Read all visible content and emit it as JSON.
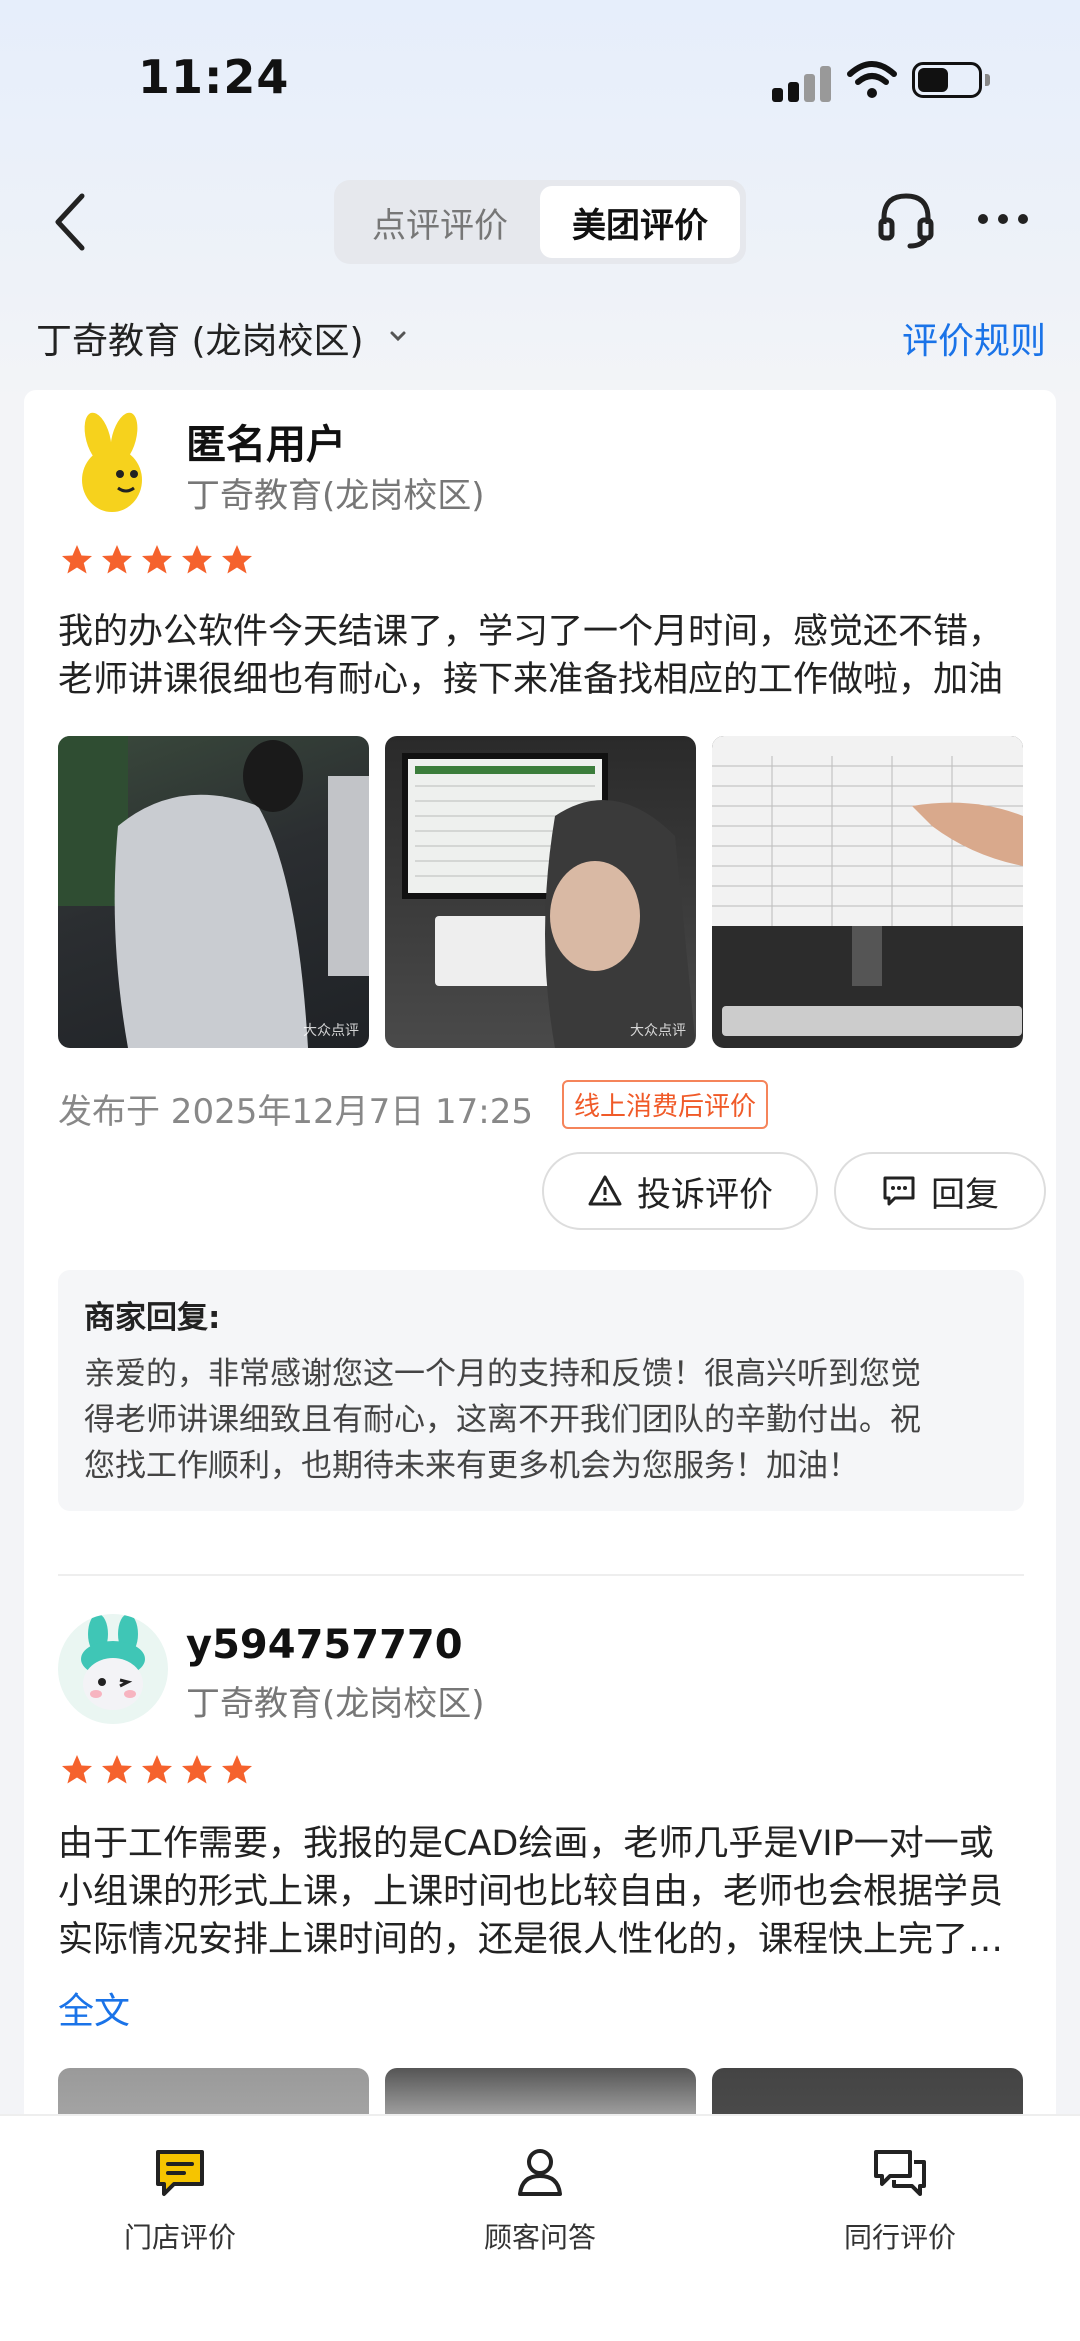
{
  "status_bar": {
    "time": "11:24"
  },
  "header": {
    "tabs": [
      {
        "label": "点评评价",
        "active": false
      },
      {
        "label": "美团评价",
        "active": true
      }
    ],
    "icons": [
      "back-icon",
      "headset-icon",
      "more-icon"
    ]
  },
  "shop": {
    "name": "丁奇教育 (龙岗校区)",
    "rules_link": "评价规则"
  },
  "reviews": [
    {
      "user": "匿名用户",
      "shop": "丁奇教育(龙岗校区)",
      "rating": 5,
      "text_lines": [
        "我的办公软件今天结课了，学习了一个月时间，感觉还不错，",
        "老师讲课很细也有耐心，接下来准备找相应的工作做啦，加油"
      ],
      "photo_watermark": "大众点评",
      "published": "发布于 2025年12月7日 17:25",
      "badge": "线上消费后评价",
      "complain_label": "投诉评价",
      "reply_label": "回复",
      "merchant_reply": {
        "title": "商家回复:",
        "lines": [
          "亲爱的，非常感谢您这一个月的支持和反馈！很高兴听到您觉",
          "得老师讲课细致且有耐心，这离不开我们团队的辛勤付出。祝",
          "您找工作顺利，也期待未来有更多机会为您服务！加油！"
        ]
      }
    },
    {
      "user": "y594757770",
      "shop": "丁奇教育(龙岗校区)",
      "rating": 5,
      "text_lines": [
        "由于工作需要，我报的是CAD绘画，老师几乎是VIP一对一或",
        "小组课的形式上课，上课时间也比较自由，老师也会根据学员",
        "实际情况安排上课时间的，还是很人性化的，课程快上完了…"
      ],
      "fulltext_label": "全文"
    }
  ],
  "bottom_nav": [
    {
      "label": "门店评价",
      "icon": "message-icon",
      "active": true
    },
    {
      "label": "顾客问答",
      "icon": "person-icon",
      "active": false
    },
    {
      "label": "同行评价",
      "icon": "chat-bubbles-icon",
      "active": false
    }
  ],
  "colors": {
    "accent": "#1a73e8",
    "star": "#f5622d",
    "badge": "#f05a28",
    "active_tab_icon": "#f6c400"
  }
}
